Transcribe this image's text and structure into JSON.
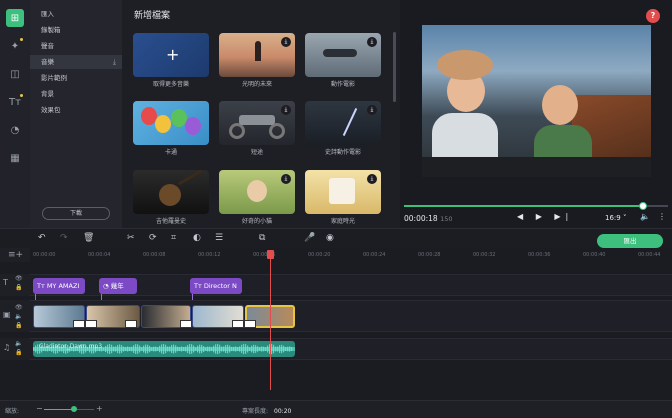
{
  "rail": {
    "items": [
      {
        "name": "import-icon",
        "glyph": "⊞",
        "active": true
      },
      {
        "name": "magic-wand-icon",
        "glyph": "✦",
        "active": false
      },
      {
        "name": "transitions-icon",
        "glyph": "◫",
        "active": false
      },
      {
        "name": "titles-icon",
        "glyph": "Tт",
        "active": false
      },
      {
        "name": "clock-icon",
        "glyph": "◔",
        "active": false
      },
      {
        "name": "apps-grid-icon",
        "glyph": "▦",
        "active": false
      }
    ]
  },
  "categories": {
    "items": [
      "匯入",
      "錄製箱",
      "聲音",
      "音樂",
      "影片範例",
      "背景",
      "效果包"
    ],
    "active_index": 3,
    "download_label": "下載"
  },
  "library": {
    "title": "新增檔案",
    "items": [
      {
        "label": "取得更多音樂"
      },
      {
        "label": "光明的未來"
      },
      {
        "label": "動作電影"
      },
      {
        "label": "卡通"
      },
      {
        "label": "短途"
      },
      {
        "label": "史詩動作電影"
      },
      {
        "label": "吉他羅曼史"
      },
      {
        "label": "好奇的小貓"
      },
      {
        "label": "家庭時光"
      }
    ]
  },
  "preview": {
    "help_label": "?",
    "time": "00:00:18",
    "time_ms": "150",
    "aspect_ratio": "16:9 ˅",
    "controls": "◀ ▶ ▶|",
    "volume_icon": "🔈",
    "more_icon": "⋮"
  },
  "toolbar": {
    "export_label": "匯出",
    "tools": [
      "↶",
      "↷",
      "🗑",
      "✂",
      "⟳",
      "⌗",
      "◐",
      "☰",
      "⧉",
      "🎤",
      "◉"
    ]
  },
  "timeline": {
    "ticks": [
      "00:00:00",
      "00:00:04",
      "00:00:08",
      "00:00:12",
      "00:00:16",
      "00:00:20",
      "00:00:24",
      "00:00:28",
      "00:00:32",
      "00:00:36",
      "00:00:40",
      "00:00:44"
    ],
    "title_clips": [
      {
        "text": "Tт MY AMAZI"
      },
      {
        "text": "◔ 幾年"
      },
      {
        "text": "Tт Director N"
      }
    ],
    "audio_label": "Gladiator_Dawn.mp3"
  },
  "status": {
    "zoom_label": "縮放:",
    "project_length_label": "專案長度:",
    "project_length_value": "00:20"
  },
  "colors": {
    "accent": "#3dbf7d",
    "title_clip": "#7b4ac4",
    "audio_clip": "#2a8a7c",
    "playhead": "#e24d4d"
  }
}
